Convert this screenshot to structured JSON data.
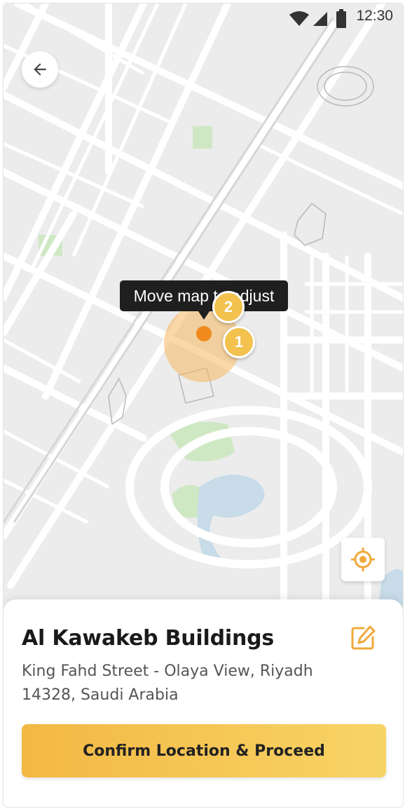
{
  "status_bar": {
    "time": "12:30"
  },
  "map": {
    "tooltip": "Move map to adjust",
    "badges": [
      "2",
      "1"
    ]
  },
  "location": {
    "name": "Al Kawakeb Buildings",
    "address": "King Fahd Street - Olaya View, Riyadh 14328, Saudi Arabia"
  },
  "confirm_label": "Confirm Location & Proceed",
  "icons": {
    "back": "arrow-left-icon",
    "locate": "crosshair-icon",
    "edit": "edit-icon",
    "wifi": "wifi-icon",
    "signal": "signal-icon",
    "battery": "battery-icon"
  },
  "colors": {
    "accent": "#F2C14E",
    "accent_dark": "#F3B843",
    "pin": "#F08A1C"
  }
}
